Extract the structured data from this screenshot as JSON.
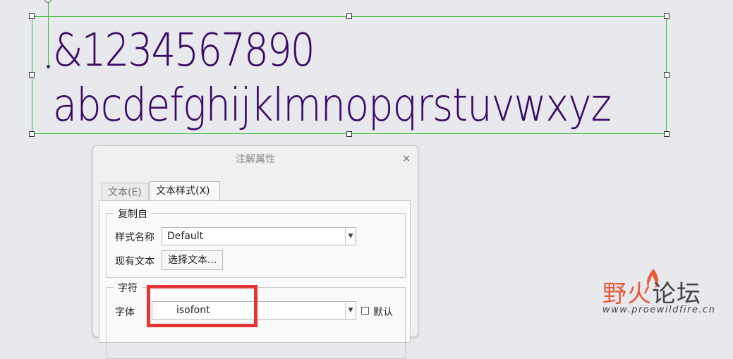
{
  "annotation": {
    "line1": "&1234567890",
    "line2": "abcdefghijklmnopqrstuvwxyz"
  },
  "dialog": {
    "title": "注解属性",
    "close_glyph": "×",
    "tabs": [
      {
        "label": "文本(E)",
        "active": false
      },
      {
        "label": "文本样式(X)",
        "active": true
      }
    ],
    "copy_from": {
      "legend": "复制自",
      "style_name_label": "样式名称",
      "style_name_value": "Default",
      "existing_text_label": "现有文本",
      "select_text_button": "选择文本..."
    },
    "character": {
      "legend": "字符",
      "font_label": "字体",
      "font_value": "isofont",
      "default_checkbox_label": "默认",
      "default_checked": false
    }
  },
  "watermark": {
    "cn_part1": "野火",
    "cn_part2": "论坛",
    "url": "www.proewildfire.cn"
  },
  "colors": {
    "annotation_text": "#3a0a66",
    "selection_box": "#3fbf3f",
    "highlight": "#e53434",
    "brand": "#e85a3c"
  }
}
